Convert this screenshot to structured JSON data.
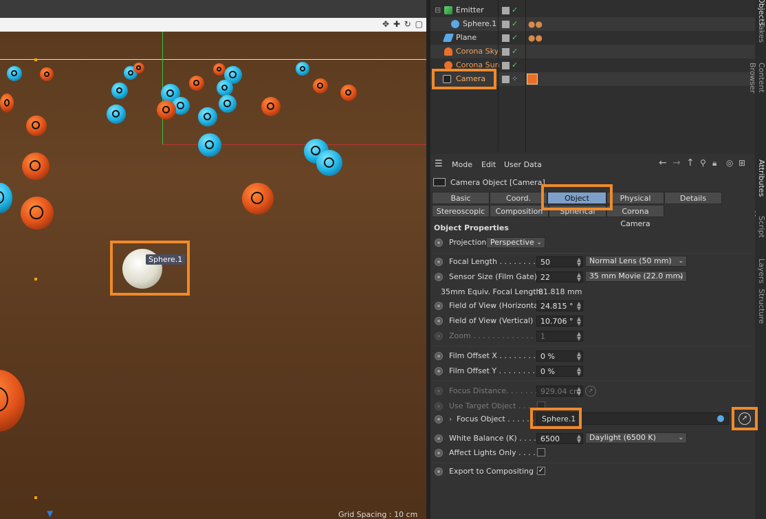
{
  "viewport": {
    "object_tag": "Sphere.1",
    "grid_spacing": "Grid Spacing : 10 cm",
    "nav_icons": "✥ ✚ ↻ ▢"
  },
  "object_manager": {
    "items": [
      {
        "name": "Emitter",
        "icon": "emitter-icon"
      },
      {
        "name": "Sphere.1",
        "icon": "sphere-icon"
      },
      {
        "name": "Plane",
        "icon": "plane-icon"
      },
      {
        "name": "Corona Sky",
        "icon": "sky-icon"
      },
      {
        "name": "Corona Sun",
        "icon": "sun-icon"
      },
      {
        "name": "Camera",
        "icon": "camera-icon"
      }
    ]
  },
  "side_tabs": [
    "Objects",
    "Takes",
    "Content Browser",
    "Attributes",
    "Script Manager",
    "Layers",
    "Structure"
  ],
  "attributes": {
    "menu": {
      "mode": "Mode",
      "edit": "Edit",
      "user_data": "User Data"
    },
    "title": "Camera Object [Camera]",
    "tabs_row1": [
      "Basic",
      "Coord.",
      "Object",
      "Physical",
      "Details"
    ],
    "tabs_row2": [
      "Stereoscopic",
      "Composition",
      "Spherical",
      "Corona Camera"
    ],
    "active_tab": "Object",
    "section": "Object Properties",
    "projection": {
      "label": "Projection",
      "value": "Perspective"
    },
    "focal_length": {
      "label": "Focal Length . . . . . . . .",
      "value": "50",
      "preset": "Normal Lens (50 mm)"
    },
    "sensor_size": {
      "label": "Sensor Size (Film Gate)",
      "value": "22",
      "preset": "35 mm Movie (22.0 mm)"
    },
    "equiv_focal": {
      "label": "35mm Equiv. Focal Length:",
      "value": "81.818 mm"
    },
    "fov_h": {
      "label": "Field of View (Horizontal)",
      "value": "24.815 °"
    },
    "fov_v": {
      "label": "Field of View (Vertical) . .",
      "value": "10.706 °"
    },
    "zoom": {
      "label": "Zoom . . . . . . . . . . . . .",
      "value": "1"
    },
    "film_offset_x": {
      "label": "Film Offset X . . . . . . . .",
      "value": "0 %"
    },
    "film_offset_y": {
      "label": "Film Offset Y . . . . . . . .",
      "value": "0 %"
    },
    "focus_distance": {
      "label": "Focus Distance. . . . . . . .",
      "value": "929.04 cm"
    },
    "use_target": {
      "label": "Use Target Object . . . . ."
    },
    "focus_object": {
      "label": "Focus Object  . . . . . .",
      "value": "Sphere.1"
    },
    "white_balance": {
      "label": "White Balance (K) . . . . .",
      "value": "6500",
      "preset": "Daylight (6500 K)"
    },
    "affect_lights": {
      "label": "Affect Lights Only . . . . .",
      "checked": false
    },
    "export_comp": {
      "label": "Export to Compositing  . .",
      "checked": true
    }
  },
  "colors": {
    "highlight": "#f08a2b",
    "active_tab": "#7ea0c8",
    "check": "#4fd16a"
  }
}
